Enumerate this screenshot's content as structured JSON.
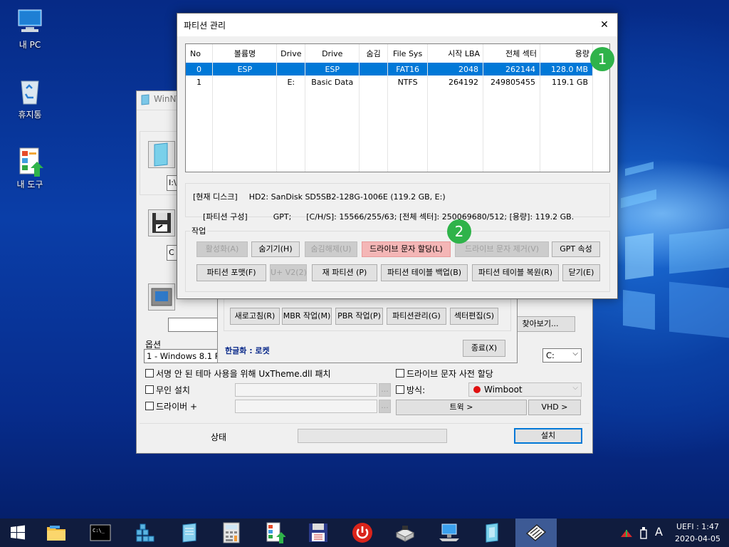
{
  "desktop": {
    "icons": [
      {
        "label": "내 PC",
        "icon": "computer-icon"
      },
      {
        "label": "휴지통",
        "icon": "recycle-bin-icon"
      },
      {
        "label": "내 도구",
        "icon": "tools-icon"
      }
    ]
  },
  "winntsetup": {
    "title": "WinNT",
    "field1_value": "I:\\",
    "field2_value": "C",
    "options_label": "옵션",
    "options_select": "1 - Windows 8.1 P",
    "drive_select": "C:",
    "browse_button": "찾아보기...",
    "checks": {
      "uxtheme": "서명 안 된 테마 사용을 위해 UxTheme.dll 패치",
      "unattended": "무인 설치",
      "driver": "드라이버 +",
      "drive_letter": "드라이브 문자 사전 할당",
      "method": "방식:"
    },
    "method_value": "Wimboot",
    "ellipsis": "...",
    "tweak_button": "트윅 >",
    "vhd_button": "VHD >",
    "status_label": "상태",
    "install_button": "설치"
  },
  "tools_dialog": {
    "buttons": [
      "새로고침(R)",
      "MBR 작업(M)",
      "PBR 작업(P)",
      "파티션관리(G)",
      "섹터편집(S)"
    ],
    "credit": "한글화 : 로켓",
    "close_button": "종료(X)"
  },
  "partition_dialog": {
    "title": "파티션 관리",
    "close_glyph": "✕",
    "columns": [
      "No",
      "볼륨명",
      "Drive",
      "Drive",
      "숨김",
      "File Sys",
      "시작 LBA",
      "전체 섹터",
      "용량"
    ],
    "rows": [
      [
        "0",
        "ESP",
        "",
        "ESP",
        "",
        "FAT16",
        "2048",
        "262144",
        "128.0 MB"
      ],
      [
        "1",
        "",
        "E:",
        "Basic Data",
        "",
        "NTFS",
        "264192",
        "249805455",
        "119.1 GB"
      ]
    ],
    "info_line1_label": "[현재 디스크]",
    "info_line1_value": "HD2: SanDisk SD5SB2-128G-1006E (119.2 GB, E:)",
    "info_line2_label": "[파티션 구성]",
    "info_line2_value": "GPT;      [C/H/S]: 15566/255/63; [전체 섹터]: 250069680/512; [용량]: 119.2 GB.",
    "tasks_label": "작업",
    "task_row1": [
      {
        "label": "활성화(A)",
        "disabled": true
      },
      {
        "label": "숨기기(H)",
        "disabled": false
      },
      {
        "label": "숨김해제(U)",
        "disabled": true
      },
      {
        "label": "드라이브 문자 할당(L)",
        "disabled": false
      },
      {
        "label": "드라이브 문자 제거(V)",
        "disabled": true
      },
      {
        "label": "GPT 속성",
        "disabled": false
      }
    ],
    "task_row2": [
      {
        "label": "파티션 포맷(F)",
        "disabled": false
      },
      {
        "label": "U+ V2(2)",
        "disabled": true
      },
      {
        "label": "재 파티션 (P)",
        "disabled": false
      },
      {
        "label": "파티션 테이블 백업(B)",
        "disabled": false
      },
      {
        "label": "파티션 테이블 복원(R)",
        "disabled": false
      },
      {
        "label": "닫기(E)",
        "disabled": false
      }
    ],
    "badges": [
      "1",
      "2"
    ]
  },
  "taskbar": {
    "items": [
      "windows-start-icon",
      "file-explorer-icon",
      "command-prompt-icon",
      "registry-icon",
      "notepad-icon",
      "calculator-icon",
      "tools-icon",
      "floppy-save-icon",
      "power-icon",
      "installer-icon",
      "network-computer-icon",
      "setup-icon",
      "partition-tool-icon"
    ],
    "clock_line1": "UEFI : 1:47",
    "clock_line2": "2020-04-05",
    "ime": "A"
  },
  "colors": {
    "selection": "#0078d7",
    "highlight": "#f4b6b6",
    "badge": "#2fb34a",
    "taskbar": "#101c3e"
  }
}
